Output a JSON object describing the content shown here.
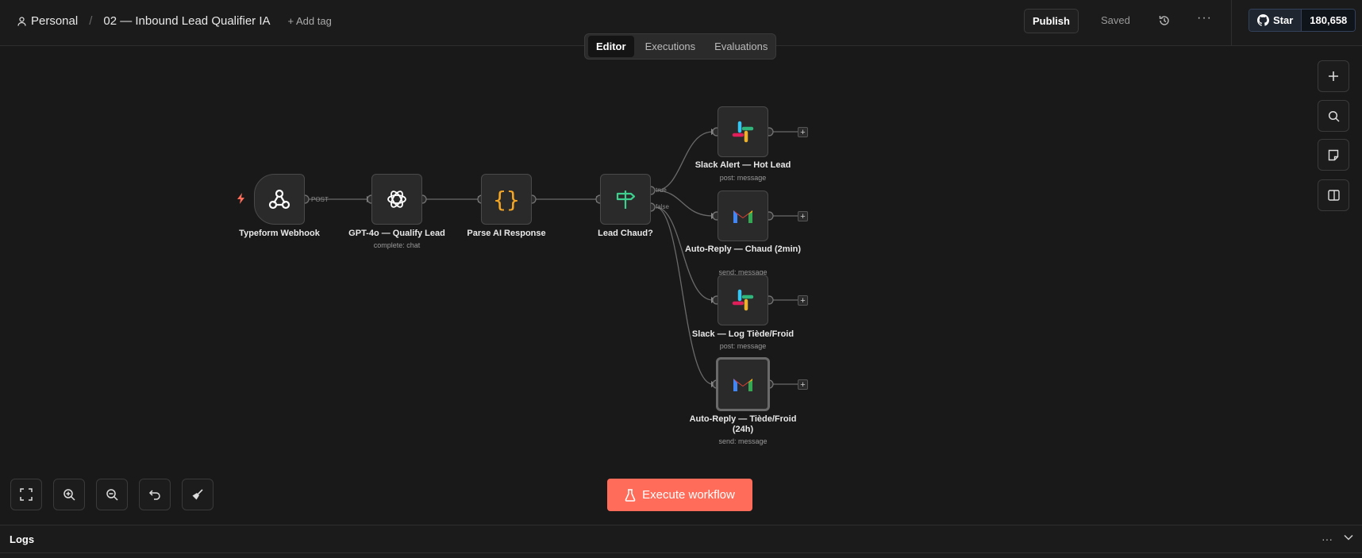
{
  "header": {
    "workspace": "Personal",
    "separator": "/",
    "workflow_name": "02 — Inbound Lead Qualifier IA",
    "add_tag": "+ Add tag",
    "publish": "Publish",
    "saved": "Saved",
    "github_star": "Star",
    "github_count": "180,658"
  },
  "tabs": [
    "Editor",
    "Executions",
    "Evaluations"
  ],
  "active_tab": "Editor",
  "nodes": {
    "webhook": {
      "label": "Typeform Webhook",
      "icon": "webhook-icon"
    },
    "gpt": {
      "label": "GPT-4o — Qualify Lead",
      "sub": "complete: chat",
      "icon": "openai-icon"
    },
    "parse": {
      "label": "Parse AI Response",
      "icon": "code-braces-icon"
    },
    "if": {
      "label": "Lead Chaud?",
      "icon": "signpost-icon"
    },
    "slack_hot": {
      "label": "Slack Alert — Hot Lead",
      "sub": "post: message",
      "icon": "slack-icon"
    },
    "reply_hot": {
      "label": "Auto-Reply — Chaud (2min)",
      "sub": "send: message",
      "icon": "gmail-icon"
    },
    "slack_log": {
      "label": "Slack — Log Tiède/Froid",
      "sub": "post: message",
      "icon": "slack-icon"
    },
    "reply_cold": {
      "label": "Auto-Reply — Tiède/Froid (24h)",
      "sub": "send: message",
      "icon": "gmail-icon"
    }
  },
  "edge_labels": {
    "post": "POST",
    "true": "true",
    "false": "false"
  },
  "execute_button": "Execute workflow",
  "logs": {
    "title": "Logs"
  },
  "colors": {
    "accent": "#ff6d5a",
    "canvas": "#191919"
  }
}
